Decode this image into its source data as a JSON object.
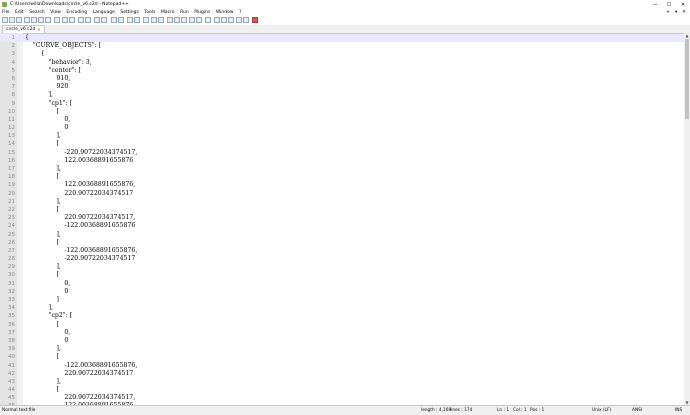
{
  "window": {
    "title": "C:\\Users\\willa\\Downloads\\circle_v6.c2d - Notepad++",
    "minimize": "—",
    "maximize": "☐",
    "close": "✕"
  },
  "menu": {
    "items": [
      "File",
      "Edit",
      "Search",
      "View",
      "Encoding",
      "Language",
      "Settings",
      "Tools",
      "Macro",
      "Run",
      "Plugins",
      "Window",
      "?"
    ],
    "right": [
      "+",
      "▾",
      "✕"
    ]
  },
  "tab": {
    "label": "circle_v6.c2d",
    "close": "✕"
  },
  "editor": {
    "current_line": 1,
    "lines": [
      "{",
      "    \"CURVE_OBJECTS\": [",
      "        {",
      "            \"behavior\": 3,",
      "            \"center\": [",
      "                910,",
      "                920",
      "            ],",
      "            \"cp1\": [",
      "                [",
      "                    0,",
      "                    0",
      "                ],",
      "                [",
      "                    -220.90722034374517,",
      "                    122.00368891655876",
      "                ],",
      "                [",
      "                    122.00368891655876,",
      "                    220.90722034374517",
      "                ],",
      "                [",
      "                    220.90722034374517,",
      "                    -122.00368891655876",
      "                ],",
      "                [",
      "                    -122.00368891655876,",
      "                    -220.90722034374517",
      "                ],",
      "                [",
      "                    0,",
      "                    0",
      "                ]",
      "            ],",
      "            \"cp2\": [",
      "                [",
      "                    0,",
      "                    0",
      "                ],",
      "                [",
      "                    -122.00368891655876,",
      "                    220.90722034374517",
      "                ],",
      "                [",
      "                    220.90722034374517,",
      "                    122.00368891655876"
    ]
  },
  "status": {
    "file_type": "Normal text file",
    "length": "length : 4,169",
    "lines": "lines : 174",
    "ln": "Ln : 1",
    "col": "Col : 1",
    "pos": "Pos : 1",
    "eol": "Unix (LF)",
    "encoding": "ANSI",
    "mode": "INS"
  }
}
